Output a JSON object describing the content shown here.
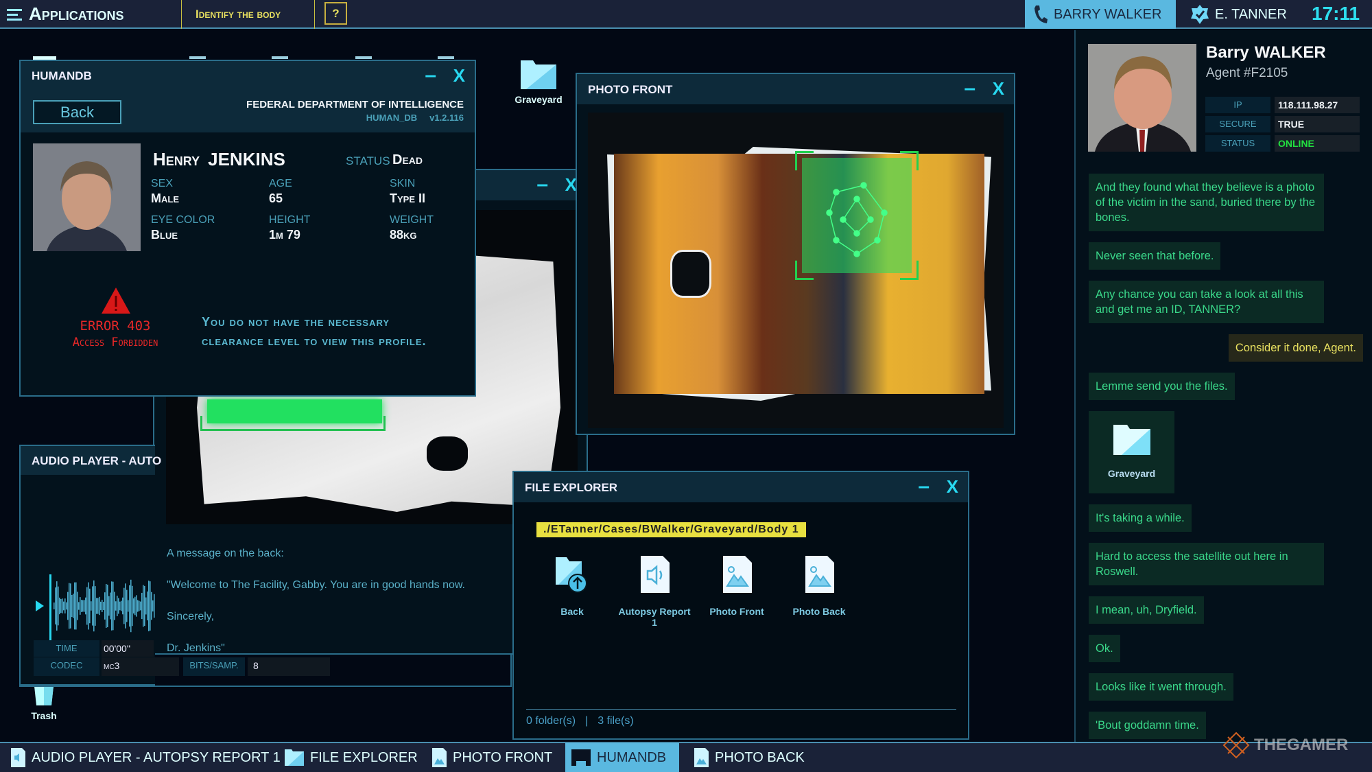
{
  "topbar": {
    "apps_label": "Applications",
    "task_title": "Identify the body",
    "help_label": "?",
    "contact_name": "BARRY WALKER",
    "user_name": "E. TANNER",
    "clock": "17:11"
  },
  "desktop": {
    "icons": [
      {
        "label": "Graveyard",
        "icon": "folder-icon"
      },
      {
        "label": "Trash",
        "icon": "trash-icon"
      }
    ]
  },
  "humandb": {
    "title": "HUMANDB",
    "back_label": "Back",
    "org": "FEDERAL DEPARTMENT OF INTELLIGENCE",
    "app_name": "HUMAN_DB",
    "version": "v1.2.116",
    "first_name": "Henry",
    "last_name": "JENKINS",
    "status_label": "STATUS",
    "status_value": "Dead",
    "fields": [
      {
        "label": "SEX",
        "value": "Male"
      },
      {
        "label": "AGE",
        "value": "65"
      },
      {
        "label": "SKIN",
        "value": "Type II"
      },
      {
        "label": "EYE COLOR",
        "value": "Blue"
      },
      {
        "label": "HEIGHT",
        "value": "1m 79"
      },
      {
        "label": "WEIGHT",
        "value": "88kg"
      }
    ],
    "error_code": "ERROR 403",
    "error_text": "Access Forbidden",
    "error_message_1": "You do not have the necessary",
    "error_message_2": "clearance level to view this profile."
  },
  "photo_back": {
    "lines": [
      "A message on the back:",
      "\"Welcome to The Facility, Gabby. You are in good hands now.",
      "Sincerely,",
      "Dr. Jenkins\""
    ]
  },
  "audio_player": {
    "title": "AUDIO PLAYER - AUTO",
    "time_label": "TIME",
    "time_value": "00'00''",
    "codec_label": "CODEC",
    "codec_value": "mc3",
    "bits_label": "BITS/SAMP.",
    "bits_value": "8"
  },
  "photo_front": {
    "title": "PHOTO FRONT"
  },
  "file_explorer": {
    "title": "FILE EXPLORER",
    "path": "./ETanner/Cases/BWalker/Graveyard/Body 1",
    "items": [
      {
        "label": "Back",
        "icon": "folder-up-icon"
      },
      {
        "label": "Autopsy Report 1",
        "icon": "audio-file-icon"
      },
      {
        "label": "Photo Front",
        "icon": "image-file-icon"
      },
      {
        "label": "Photo Back",
        "icon": "image-file-icon"
      }
    ],
    "folders": "0 folder(s)",
    "separator": "|",
    "files": "3 file(s)"
  },
  "contact": {
    "name_first": "Barry",
    "name_last": "WALKER",
    "agent_id": "Agent #F2105",
    "ip_label": "IP",
    "ip_value": "118.111.98.27",
    "secure_label": "SECURE",
    "secure_value": "TRUE",
    "status_label": "STATUS",
    "status_value": "ONLINE",
    "status_color": "#22e040"
  },
  "chat": {
    "m0": "And they found what they believe is a photo of the victim in the sand, buried there by the bones.",
    "m1": "Never seen that before.",
    "m2": "Any chance you can take a look at all this and get me an ID, TANNER?",
    "m3": "Consider it done, Agent.",
    "m4": "Lemme send you the files.",
    "attachment": "Graveyard",
    "m5": "It's taking a while.",
    "m6": "Hard to access the satellite out here in Roswell.",
    "m7": "I mean, uh, Dryfield.",
    "m8": "Ok.",
    "m9": "Looks like it went through.",
    "m10": "'Bout goddamn time."
  },
  "taskbar": {
    "items": [
      {
        "label": "AUDIO PLAYER - AUTOPSY REPORT 1",
        "icon": "audio-file-icon"
      },
      {
        "label": "FILE EXPLORER",
        "icon": "folder-icon"
      },
      {
        "label": "PHOTO FRONT",
        "icon": "image-file-icon"
      },
      {
        "label": "HUMANDB",
        "icon": "database-icon",
        "active": true
      },
      {
        "label": "PHOTO BACK",
        "icon": "image-file-icon"
      }
    ]
  },
  "watermark": "THEGAMER",
  "colors": {
    "accent": "#28d8f0",
    "highlight": "#5ab8e0",
    "error": "#e02020",
    "path_bg": "#e8e040",
    "chat_text": "#3ad88a"
  }
}
